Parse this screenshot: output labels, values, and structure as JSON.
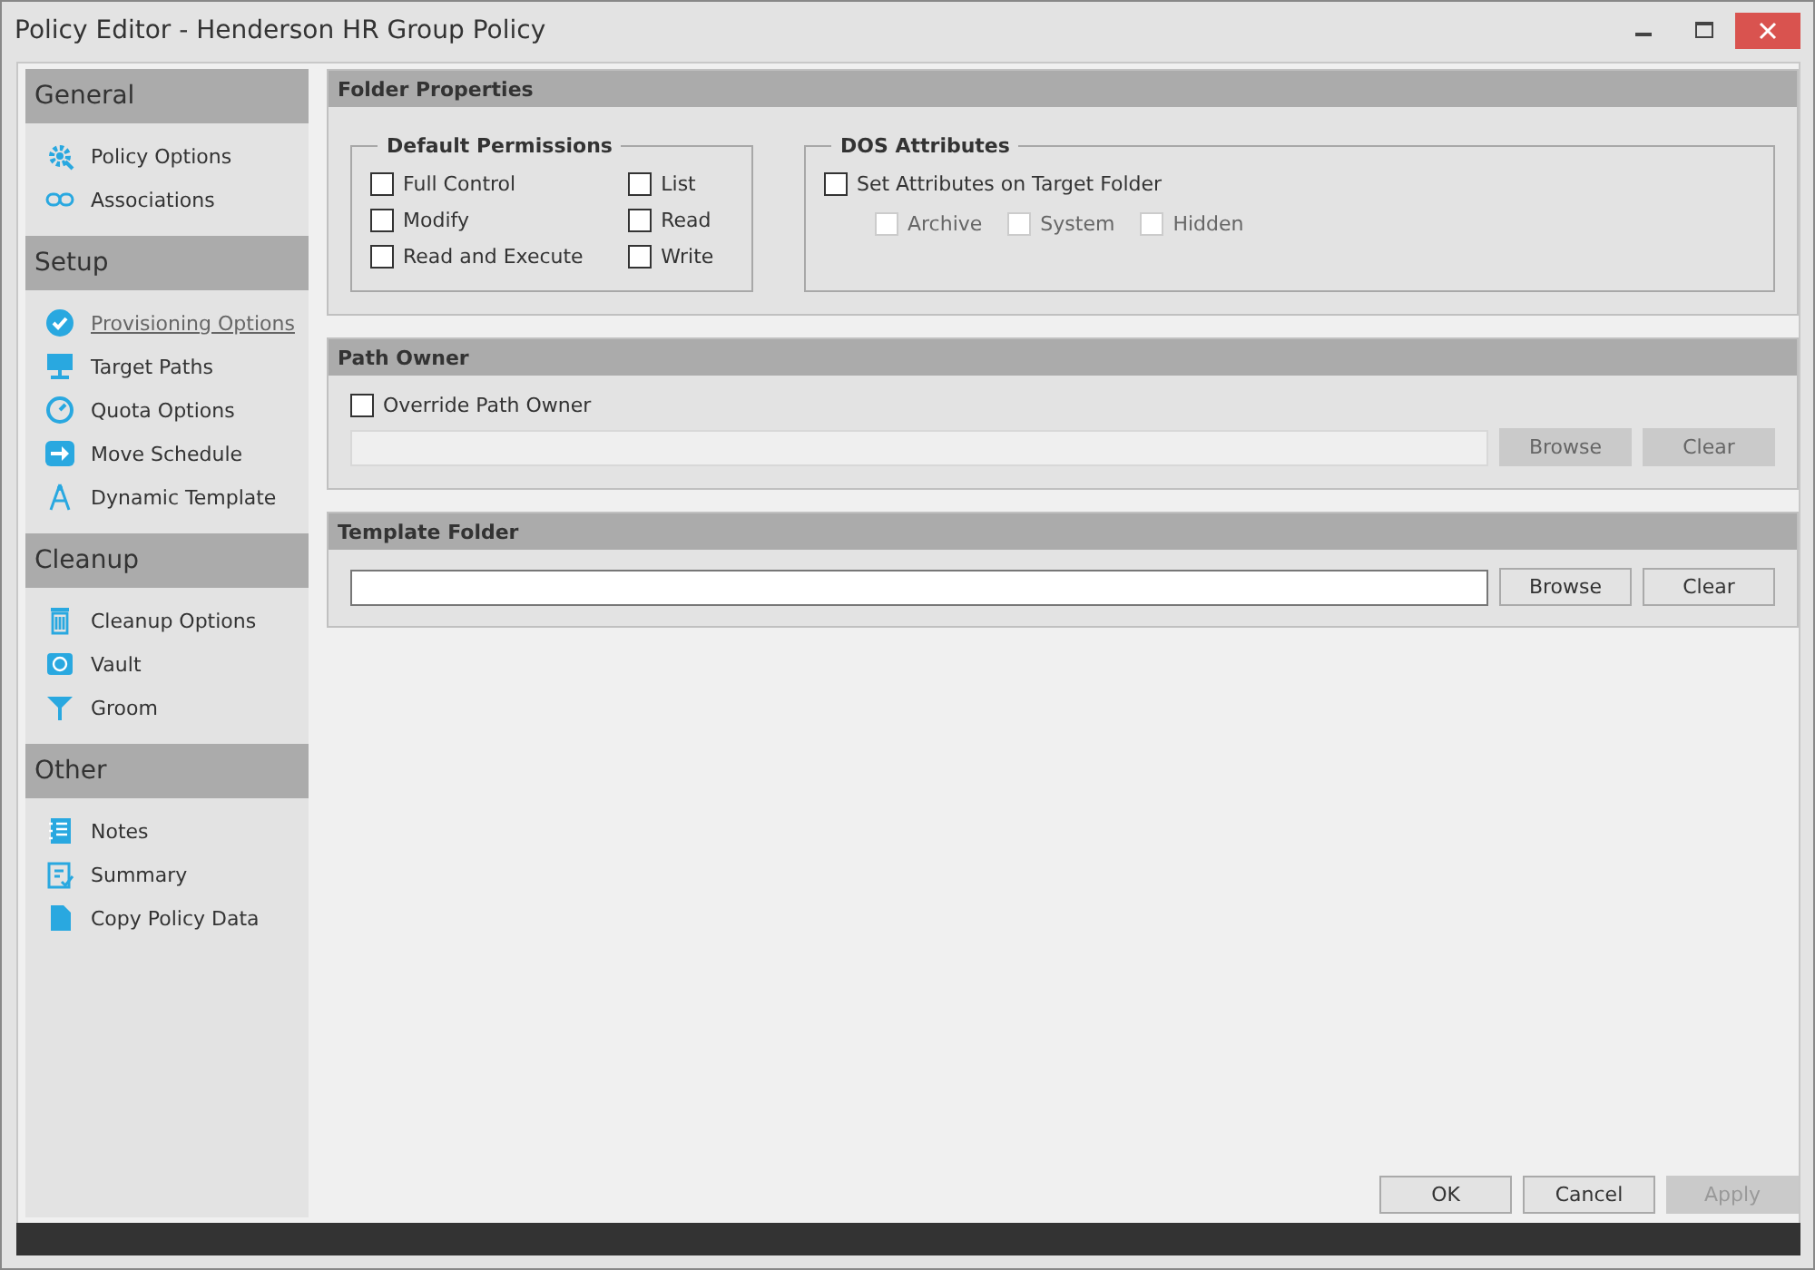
{
  "window": {
    "title": "Policy Editor - Henderson HR Group Policy"
  },
  "sidebar": {
    "sections": [
      {
        "title": "General",
        "items": [
          {
            "label": "Policy Options",
            "kind": "gear",
            "selected": false
          },
          {
            "label": "Associations",
            "kind": "link",
            "selected": false
          }
        ]
      },
      {
        "title": "Setup",
        "items": [
          {
            "label": "Provisioning Options",
            "kind": "check",
            "selected": true
          },
          {
            "label": "Target Paths",
            "kind": "monitor",
            "selected": false
          },
          {
            "label": "Quota Options",
            "kind": "gauge",
            "selected": false
          },
          {
            "label": "Move Schedule",
            "kind": "arrow",
            "selected": false
          },
          {
            "label": "Dynamic Template",
            "kind": "compass",
            "selected": false
          }
        ]
      },
      {
        "title": "Cleanup",
        "items": [
          {
            "label": "Cleanup Options",
            "kind": "trash",
            "selected": false
          },
          {
            "label": "Vault",
            "kind": "safe",
            "selected": false
          },
          {
            "label": "Groom",
            "kind": "funnel",
            "selected": false
          }
        ]
      },
      {
        "title": "Other",
        "items": [
          {
            "label": "Notes",
            "kind": "notepad",
            "selected": false
          },
          {
            "label": "Summary",
            "kind": "clipboard",
            "selected": false
          },
          {
            "label": "Copy Policy Data",
            "kind": "document",
            "selected": false
          }
        ]
      }
    ]
  },
  "folder_properties": {
    "title": "Folder Properties",
    "default_permissions": {
      "title": "Default Permissions",
      "options": [
        {
          "label": "Full Control",
          "checked": false
        },
        {
          "label": "List",
          "checked": false
        },
        {
          "label": "Modify",
          "checked": false
        },
        {
          "label": "Read",
          "checked": false
        },
        {
          "label": "Read and Execute",
          "checked": false
        },
        {
          "label": "Write",
          "checked": false
        }
      ]
    },
    "dos_attributes": {
      "title": "DOS Attributes",
      "set_attributes": {
        "label": "Set Attributes on Target Folder",
        "checked": false
      },
      "attributes": [
        {
          "label": "Archive",
          "checked": false,
          "disabled": true
        },
        {
          "label": "System",
          "checked": false,
          "disabled": true
        },
        {
          "label": "Hidden",
          "checked": false,
          "disabled": true
        }
      ]
    }
  },
  "path_owner": {
    "title": "Path Owner",
    "override": {
      "label": "Override Path Owner",
      "checked": false
    },
    "field_disabled": true,
    "buttons": [
      {
        "label": "Browse",
        "disabled": true
      },
      {
        "label": "Clear",
        "disabled": true
      }
    ]
  },
  "template_folder": {
    "title": "Template Folder",
    "field_disabled": false,
    "buttons": [
      {
        "label": "Browse",
        "disabled": false
      },
      {
        "label": "Clear",
        "disabled": false
      }
    ]
  },
  "buttons": [
    {
      "label": "OK",
      "disabled": false
    },
    {
      "label": "Cancel",
      "disabled": false
    },
    {
      "label": "Apply",
      "disabled": true
    }
  ]
}
